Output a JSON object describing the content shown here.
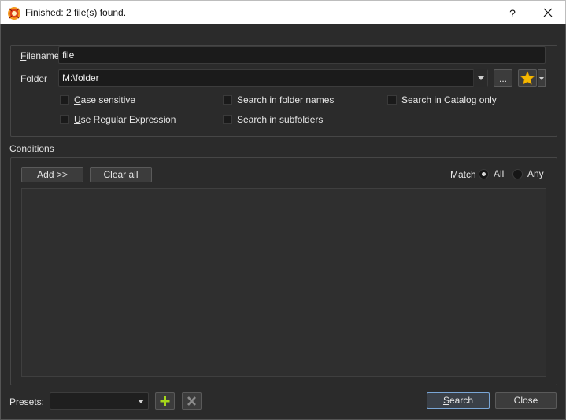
{
  "window": {
    "title": "Finished: 2 file(s) found.",
    "help_label": "?",
    "icons": {
      "app": "xnview-app-icon",
      "close": "close-icon"
    }
  },
  "search": {
    "filename_label_u": "F",
    "filename_label_rest": "ilename",
    "filename_value": "file",
    "folder_label_pre": "F",
    "folder_label_u": "o",
    "folder_label_rest": "lder",
    "folder_value": "M:\\folder",
    "browse_label": "...",
    "favorites_icon": "star-icon",
    "options": {
      "case_sensitive_u": "C",
      "case_sensitive_rest": "ase sensitive",
      "use_regex_u": "U",
      "use_regex_rest": "se Regular Expression",
      "search_folder_names": "Search in folder names",
      "search_subfolders": "Search in subfolders",
      "search_catalog_only": "Search in Catalog only"
    }
  },
  "conditions": {
    "label": "Conditions",
    "add_label": "Add >>",
    "clear_label": "Clear all",
    "match_label": "Match",
    "match_all": "All",
    "match_any": "Any",
    "match_selected": "All"
  },
  "footer": {
    "presets_label": "Presets:",
    "presets_value": "",
    "add_preset_icon": "plus-icon",
    "delete_preset_icon": "delete-x-icon",
    "search_label_u": "S",
    "search_label_rest": "earch",
    "close_label": "Close",
    "colors": {
      "plus": "#a6d81a",
      "star": "#f5b800"
    }
  }
}
